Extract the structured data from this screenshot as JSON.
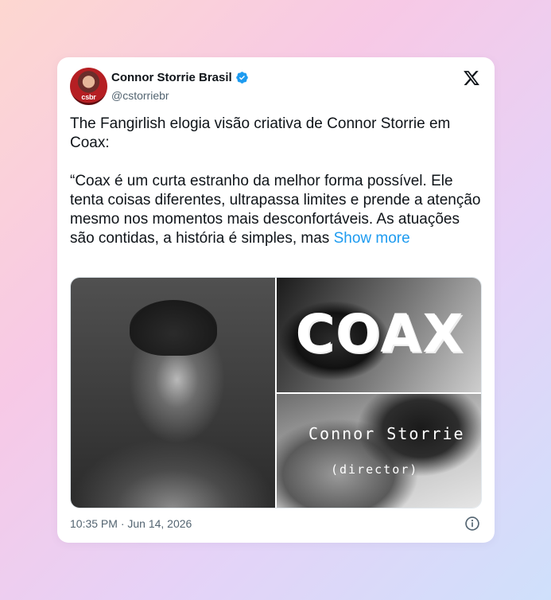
{
  "author": {
    "name": "Connor Storrie Brasil",
    "handle": "@cstorriebr",
    "avatar_tag": "csbr",
    "verified_color": "#1d9bf0"
  },
  "tweet": {
    "line1": "The Fangirlish elogia visão criativa de Connor Storrie em Coax:",
    "quote": "“Coax é um curta estranho da melhor forma possível. Ele tenta coisas diferentes, ultrapassa limites e prende a atenção mesmo nos momentos mais desconfortáveis. As atuações são contidas, a história é simples, mas",
    "show_more": "Show more",
    "link_color": "#1d9bf0"
  },
  "media": {
    "title_art": "COAX",
    "credit_name": "Connor Storrie",
    "credit_role": "(director)"
  },
  "footer": {
    "timestamp": "10:35 PM · Jun 14, 2026"
  },
  "icons": {
    "brand": "x-logo-icon",
    "verified": "verified-badge-icon",
    "info": "info-icon"
  }
}
